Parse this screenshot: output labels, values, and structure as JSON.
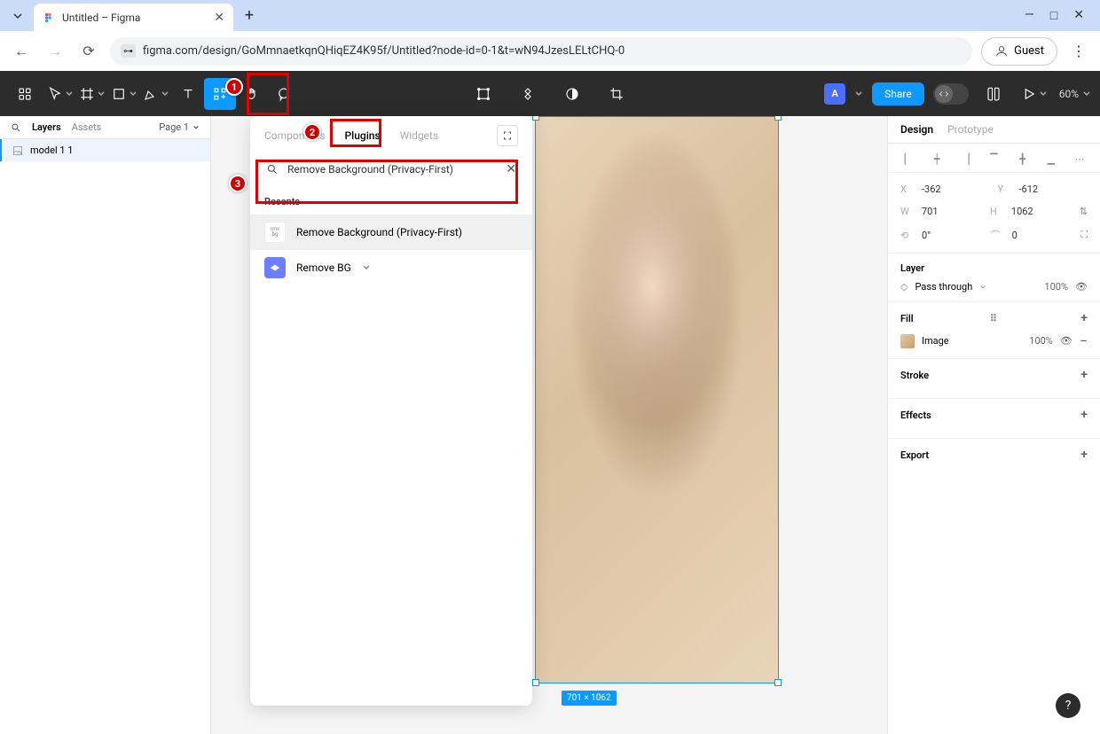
{
  "browser": {
    "tab_title": "Untitled – Figma",
    "url": "figma.com/design/GoMmnaetkqnQHiqEZ4K95f/Untitled?node-id=0-1&t=wN94JzesLELtCHQ-0",
    "guest_label": "Guest"
  },
  "figma_toolbar": {
    "avatar_letter": "A",
    "share_label": "Share",
    "zoom": "60%"
  },
  "left_panel": {
    "tab_layers": "Layers",
    "tab_assets": "Assets",
    "page_label": "Page 1",
    "layer_name": "model 1 1"
  },
  "plugins_panel": {
    "tab_components": "Components",
    "tab_plugins": "Plugins",
    "tab_widgets": "Widgets",
    "search_value": "Remove Background (Privacy-First)",
    "recents_label": "Recents",
    "items": [
      "Remove Background (Privacy-First)",
      "Remove BG"
    ]
  },
  "canvas": {
    "dim_label": "701 × 1062"
  },
  "right_panel": {
    "tab_design": "Design",
    "tab_prototype": "Prototype",
    "x_label": "X",
    "x_val": "-362",
    "y_label": "Y",
    "y_val": "-612",
    "w_label": "W",
    "w_val": "701",
    "h_label": "H",
    "h_val": "1062",
    "rot_label": "⟲",
    "rot_val": "0°",
    "rad_label": "⌒",
    "rad_val": "0",
    "layer_section": "Layer",
    "blend_mode": "Pass through",
    "layer_opacity": "100%",
    "fill_section": "Fill",
    "fill_type": "Image",
    "fill_opacity": "100%",
    "stroke_section": "Stroke",
    "effects_section": "Effects",
    "export_section": "Export"
  },
  "annotations": {
    "n1": "1",
    "n2": "2",
    "n3": "3"
  }
}
